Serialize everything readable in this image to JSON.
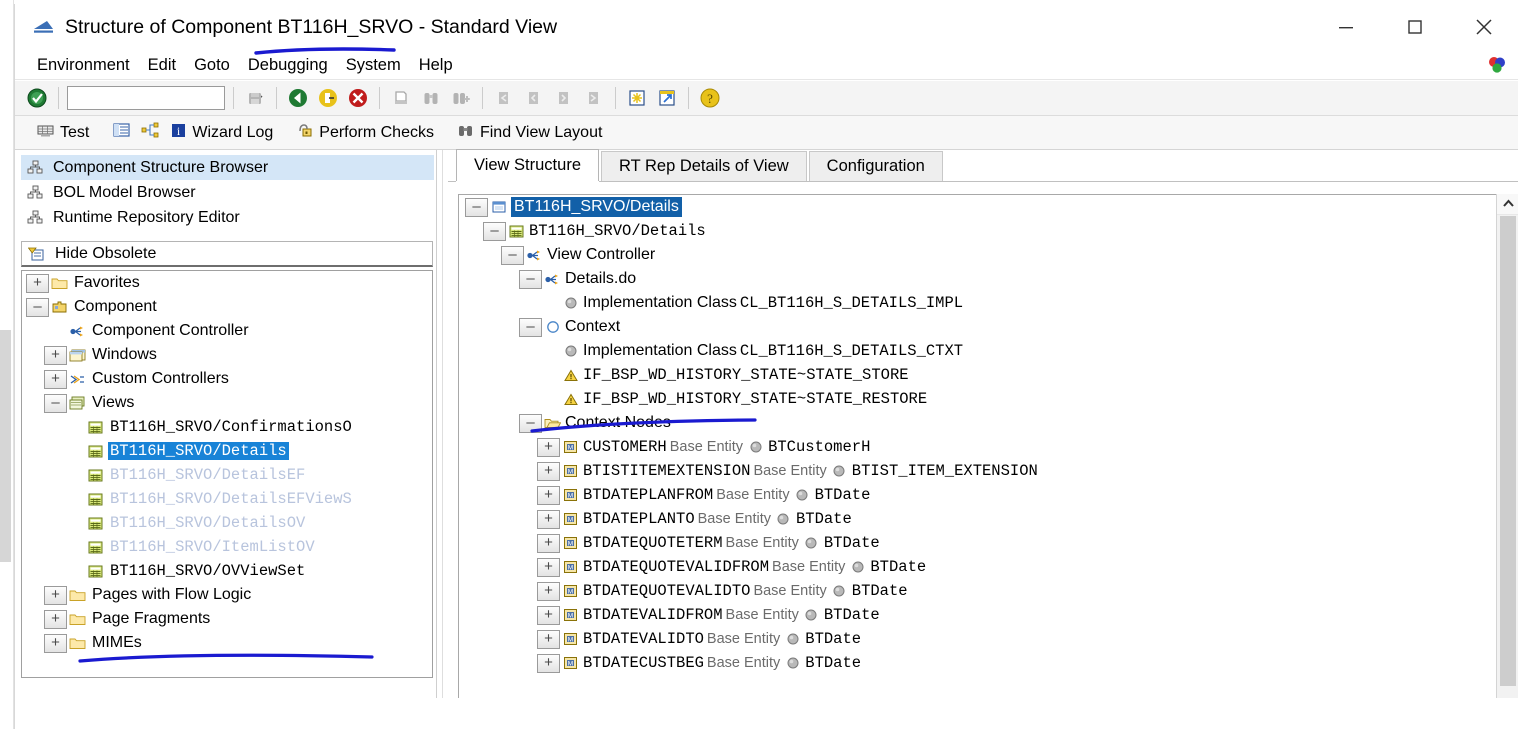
{
  "window": {
    "title": "Structure of Component BT116H_SRVO - Standard View",
    "minimize_label": "Minimize",
    "maximize_label": "Maximize",
    "close_label": "Close"
  },
  "menubar": {
    "items": [
      {
        "label": "Environment"
      },
      {
        "label": "Edit"
      },
      {
        "label": "Goto"
      },
      {
        "label": "Debugging"
      },
      {
        "label": "System"
      },
      {
        "label": "Help"
      }
    ]
  },
  "system_toolbar": {
    "enter_icon": "green-check-icon",
    "command_field": {
      "value": "",
      "placeholder": ""
    },
    "dropdown_icon": "chevron-down-icon",
    "buttons": [
      {
        "name": "save-button",
        "icon": "save-icon",
        "enabled": false
      },
      {
        "name": "back-button",
        "icon": "back-arrow-icon",
        "enabled": true
      },
      {
        "name": "exit-button",
        "icon": "exit-icon",
        "enabled": true
      },
      {
        "name": "cancel-button",
        "icon": "cancel-icon",
        "enabled": true
      },
      {
        "name": "print-button",
        "icon": "print-icon",
        "enabled": false
      },
      {
        "name": "find-button",
        "icon": "binoculars-icon",
        "enabled": false
      },
      {
        "name": "find-next-button",
        "icon": "binoculars-plus-icon",
        "enabled": false
      },
      {
        "name": "first-page-button",
        "icon": "first-page-icon",
        "enabled": false
      },
      {
        "name": "previous-page-button",
        "icon": "previous-page-icon",
        "enabled": false
      },
      {
        "name": "next-page-button",
        "icon": "next-page-icon",
        "enabled": false
      },
      {
        "name": "last-page-button",
        "icon": "last-page-icon",
        "enabled": false
      },
      {
        "name": "create-session-button",
        "icon": "new-session-icon",
        "enabled": true
      },
      {
        "name": "create-shortcut-button",
        "icon": "shortcut-arrow-icon",
        "enabled": true
      },
      {
        "name": "help-button",
        "icon": "help-question-icon",
        "enabled": true
      }
    ]
  },
  "app_toolbar": {
    "items": [
      {
        "label": "Test",
        "icon": "test-icon"
      },
      {
        "label": "",
        "icon": "list-icon"
      },
      {
        "label": "",
        "icon": "wizard-flow-icon"
      },
      {
        "label": "Wizard Log",
        "icon": "info-icon"
      },
      {
        "label": "Perform Checks",
        "icon": "checks-icon"
      },
      {
        "label": "Find View Layout",
        "icon": "binoculars-icon"
      }
    ]
  },
  "left_pane": {
    "nav_items": [
      {
        "label": "Component Structure Browser",
        "icon": "hierarchy-icon",
        "selected": true
      },
      {
        "label": "BOL Model Browser",
        "icon": "hierarchy-icon",
        "selected": false
      },
      {
        "label": "Runtime Repository Editor",
        "icon": "hierarchy-icon",
        "selected": false
      }
    ],
    "hide_obsolete": {
      "label": "Hide Obsolete",
      "icon": "filter-icon"
    },
    "tree": [
      {
        "label": "Favorites",
        "icon": "folder-icon",
        "indent": 0,
        "expander": "plus",
        "style": "normal"
      },
      {
        "label": "Component",
        "icon": "component-icon",
        "indent": 0,
        "expander": "minus",
        "style": "normal"
      },
      {
        "label": "Component Controller",
        "icon": "controller-icon",
        "indent": 1,
        "expander": "none",
        "style": "normal"
      },
      {
        "label": "Windows",
        "icon": "window-icon",
        "indent": 1,
        "expander": "plus",
        "style": "normal"
      },
      {
        "label": "Custom Controllers",
        "icon": "custom-controller-icon",
        "indent": 1,
        "expander": "plus",
        "style": "normal"
      },
      {
        "label": "Views",
        "icon": "views-icon",
        "indent": 1,
        "expander": "minus",
        "style": "normal"
      },
      {
        "label": "BT116H_SRVO/ConfirmationsO",
        "icon": "view-icon",
        "indent": 2,
        "expander": "none",
        "style": "mono"
      },
      {
        "label": "BT116H_SRVO/Details",
        "icon": "view-icon",
        "indent": 2,
        "expander": "none",
        "style": "mono-selected"
      },
      {
        "label": "BT116H_SRVO/DetailsEF",
        "icon": "view-icon",
        "indent": 2,
        "expander": "none",
        "style": "mono-obsolete"
      },
      {
        "label": "BT116H_SRVO/DetailsEFViewS",
        "icon": "view-icon",
        "indent": 2,
        "expander": "none",
        "style": "mono-obsolete"
      },
      {
        "label": "BT116H_SRVO/DetailsOV",
        "icon": "view-icon",
        "indent": 2,
        "expander": "none",
        "style": "mono-obsolete"
      },
      {
        "label": "BT116H_SRVO/ItemListOV",
        "icon": "view-icon",
        "indent": 2,
        "expander": "none",
        "style": "mono-obsolete"
      },
      {
        "label": "BT116H_SRVO/OVViewSet",
        "icon": "view-icon",
        "indent": 2,
        "expander": "none",
        "style": "mono"
      },
      {
        "label": "Pages with Flow Logic",
        "icon": "folder-icon",
        "indent": 1,
        "expander": "plus",
        "style": "normal"
      },
      {
        "label": "Page Fragments",
        "icon": "folder-icon",
        "indent": 1,
        "expander": "plus",
        "style": "normal"
      },
      {
        "label": "MIMEs",
        "icon": "folder-icon",
        "indent": 1,
        "expander": "plus",
        "style": "normal"
      }
    ]
  },
  "right_pane": {
    "tabs": [
      {
        "label": "View Structure",
        "active": true
      },
      {
        "label": "RT Rep Details of View",
        "active": false
      },
      {
        "label": "Configuration",
        "active": false
      }
    ],
    "tree": [
      {
        "label": "BT116H_SRVO/Details",
        "icon": "view-root-icon",
        "indent": 0,
        "expander": "minus",
        "style": "selected",
        "detail_label": "",
        "detail_icon": "",
        "detail_value": ""
      },
      {
        "label": "BT116H_SRVO/Details",
        "icon": "view-icon",
        "indent": 1,
        "expander": "minus",
        "style": "mono",
        "detail_label": "",
        "detail_icon": "",
        "detail_value": ""
      },
      {
        "label": "View Controller",
        "icon": "controller-icon",
        "indent": 2,
        "expander": "minus",
        "style": "normal",
        "detail_label": "",
        "detail_icon": "",
        "detail_value": ""
      },
      {
        "label": "Details.do",
        "icon": "controller-icon",
        "indent": 3,
        "expander": "minus",
        "style": "normal",
        "detail_label": "",
        "detail_icon": "",
        "detail_value": ""
      },
      {
        "label": "Implementation Class",
        "icon": "gray-ball-icon",
        "indent": 4,
        "expander": "none",
        "style": "normal",
        "detail_label": "",
        "detail_icon": "",
        "detail_value": "CL_BT116H_S_DETAILS_IMPL"
      },
      {
        "label": "Context",
        "icon": "context-circle-icon",
        "indent": 3,
        "expander": "minus",
        "style": "normal",
        "detail_label": "",
        "detail_icon": "",
        "detail_value": ""
      },
      {
        "label": "Implementation Class",
        "icon": "gray-ball-icon",
        "indent": 4,
        "expander": "none",
        "style": "normal",
        "detail_label": "",
        "detail_icon": "",
        "detail_value": "CL_BT116H_S_DETAILS_CTXT"
      },
      {
        "label": "IF_BSP_WD_HISTORY_STATE~STATE_STORE",
        "icon": "warning-triangle-icon",
        "indent": 4,
        "expander": "none",
        "style": "mono",
        "detail_label": "",
        "detail_icon": "",
        "detail_value": ""
      },
      {
        "label": "IF_BSP_WD_HISTORY_STATE~STATE_RESTORE",
        "icon": "warning-triangle-icon",
        "indent": 4,
        "expander": "none",
        "style": "mono",
        "detail_label": "",
        "detail_icon": "",
        "detail_value": ""
      },
      {
        "label": "Context Nodes",
        "icon": "open-folder-icon",
        "indent": 3,
        "expander": "minus",
        "style": "normal",
        "detail_label": "",
        "detail_icon": "",
        "detail_value": ""
      },
      {
        "label": "CUSTOMERH",
        "icon": "node-icon",
        "indent": 4,
        "expander": "plus",
        "style": "mono",
        "detail_label": "Base Entity",
        "detail_icon": "gray-ball-icon",
        "detail_value": "BTCustomerH"
      },
      {
        "label": "BTISTITEMEXTENSION",
        "icon": "node-icon",
        "indent": 4,
        "expander": "plus",
        "style": "mono",
        "detail_label": "Base Entity",
        "detail_icon": "gray-ball-icon",
        "detail_value": "BTIST_ITEM_EXTENSION"
      },
      {
        "label": "BTDATEPLANFROM",
        "icon": "node-icon",
        "indent": 4,
        "expander": "plus",
        "style": "mono",
        "detail_label": "Base Entity",
        "detail_icon": "gray-ball-icon",
        "detail_value": "BTDate"
      },
      {
        "label": "BTDATEPLANTO",
        "icon": "node-icon",
        "indent": 4,
        "expander": "plus",
        "style": "mono",
        "detail_label": "Base Entity",
        "detail_icon": "gray-ball-icon",
        "detail_value": "BTDate"
      },
      {
        "label": "BTDATEQUOTETERM",
        "icon": "node-icon",
        "indent": 4,
        "expander": "plus",
        "style": "mono",
        "detail_label": "Base Entity",
        "detail_icon": "gray-ball-icon",
        "detail_value": "BTDate"
      },
      {
        "label": "BTDATEQUOTEVALIDFROM",
        "icon": "node-icon",
        "indent": 4,
        "expander": "plus",
        "style": "mono",
        "detail_label": "Base Entity",
        "detail_icon": "gray-ball-icon",
        "detail_value": "BTDate"
      },
      {
        "label": "BTDATEQUOTEVALIDTO",
        "icon": "node-icon",
        "indent": 4,
        "expander": "plus",
        "style": "mono",
        "detail_label": "Base Entity",
        "detail_icon": "gray-ball-icon",
        "detail_value": "BTDate"
      },
      {
        "label": "BTDATEVALIDFROM",
        "icon": "node-icon",
        "indent": 4,
        "expander": "plus",
        "style": "mono",
        "detail_label": "Base Entity",
        "detail_icon": "gray-ball-icon",
        "detail_value": "BTDate"
      },
      {
        "label": "BTDATEVALIDTO",
        "icon": "node-icon",
        "indent": 4,
        "expander": "plus",
        "style": "mono",
        "detail_label": "Base Entity",
        "detail_icon": "gray-ball-icon",
        "detail_value": "BTDate"
      },
      {
        "label": "BTDATECUSTBEG",
        "icon": "node-icon",
        "indent": 4,
        "expander": "plus",
        "style": "mono",
        "detail_label": "Base Entity",
        "detail_icon": "gray-ball-icon",
        "detail_value": "BTDate"
      }
    ],
    "scrollbar": {
      "up_icon": "chevron-up-icon"
    }
  },
  "annotations": [
    {
      "name": "underline-debugging"
    },
    {
      "name": "underline-details-view"
    },
    {
      "name": "underline-context-nodes"
    }
  ],
  "colors": {
    "selection_blue": "#1883d7",
    "tree_selection_blue": "#1260a8",
    "nav_selected": "#d4e6f7",
    "annotation_blue": "#1a1ad0",
    "obsolete_gray": "#b8c4dd",
    "toolbar_bg": "#f4f4f4"
  }
}
